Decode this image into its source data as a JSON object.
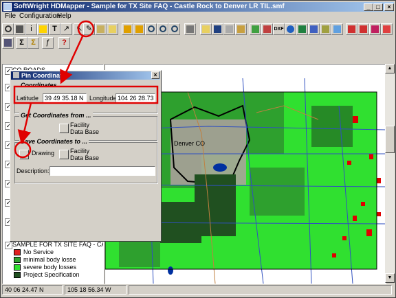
{
  "window": {
    "title": "SoftWright HDMapper - Sample for TX Site FAQ - Castle Rock to Denver LR TIL.smf",
    "minimize": "_",
    "maximize": "□",
    "close": "×"
  },
  "menu": {
    "file": "File",
    "configuration": "Configuration",
    "help": "Help"
  },
  "toolbar": {
    "text_tool": "T",
    "sigma": "Σ",
    "sigma2": "Σ",
    "question": "?",
    "dxf": "DXF"
  },
  "layers": [
    {
      "label": "CO ROADS",
      "checked": "✓"
    },
    {
      "label": "SAMPLE FOR TX SITE FAQ - CAST",
      "checked": "✓"
    }
  ],
  "legend": [
    {
      "label": "No Service",
      "color": "#e02020"
    },
    {
      "label": "minimal body losse",
      "color": "#2ea02e"
    },
    {
      "label": "severe body losses",
      "color": "#30e030"
    },
    {
      "label": "Project Specification",
      "color": "#205020"
    }
  ],
  "map": {
    "city_label": "Denver CO"
  },
  "dialog": {
    "title": "Pin Coordinates",
    "close": "×",
    "coordinates_group": "Coordinates",
    "latitude_label": "Latitude",
    "latitude_value": "39 49 35.18 N",
    "longitude_label": "Longitude",
    "longitude_value": "104 26 28.73 W",
    "get_group": "Get Coordinates from ...",
    "get_facility_label": "Facility Data Base",
    "save_group": "Save Coordinates to ...",
    "save_drawing_label": "Drawing",
    "save_facility_label": "Facility Data Base",
    "description_label": "Description:",
    "description_value": ""
  },
  "status": {
    "lat": "40 06 24.47 N",
    "lon": "105 18 56.34 W"
  },
  "colors": {
    "highlight": "#e00000",
    "map_green": "#30e030",
    "map_dark": "#205020"
  }
}
